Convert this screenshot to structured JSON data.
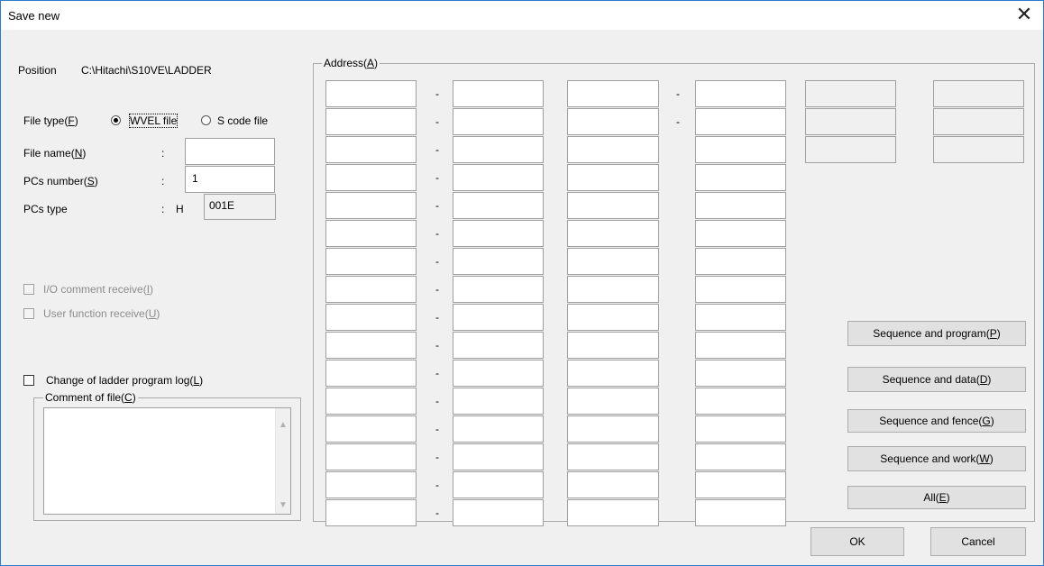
{
  "window": {
    "title": "Save new"
  },
  "position": {
    "label": "Position",
    "value": "C:\\Hitachi\\S10VE\\LADDER"
  },
  "file_type": {
    "label": "File type(",
    "mnemonic": "F",
    "option_wvel": "WVEL file",
    "option_scode": "S code file",
    "selected": "WVEL file"
  },
  "file_name": {
    "label": "File name(",
    "mnemonic": "N",
    "colon": ":",
    "value": ""
  },
  "pcs_number": {
    "label": "PCs number(",
    "mnemonic": "S",
    "colon": ":",
    "value": "1"
  },
  "pcs_type": {
    "label": "PCs type",
    "colon": ":",
    "prefix": "H",
    "value": "001E"
  },
  "io_comment": {
    "label": "I/O comment receive(",
    "mnemonic": "I"
  },
  "user_function": {
    "label": "User function receive(",
    "mnemonic": "U"
  },
  "change_log": {
    "label": "Change of ladder program log(",
    "mnemonic": "L"
  },
  "comment": {
    "label": "Comment of file(",
    "mnemonic": "C",
    "value": ""
  },
  "address": {
    "label": "Address(",
    "mnemonic": "A",
    "dash": "-"
  },
  "buttons": {
    "seq_program": {
      "label": "Sequence and program(",
      "mnemonic": "P"
    },
    "seq_data": {
      "label": "Sequence and data(",
      "mnemonic": "D"
    },
    "seq_fence": {
      "label": "Sequence and fence(",
      "mnemonic": "G"
    },
    "seq_work": {
      "label": "Sequence and work(",
      "mnemonic": "W"
    },
    "all": {
      "label": "All(",
      "mnemonic": "E"
    },
    "ok": "OK",
    "cancel": "Cancel"
  },
  "close_glyph": "✕",
  "rparen": ")"
}
